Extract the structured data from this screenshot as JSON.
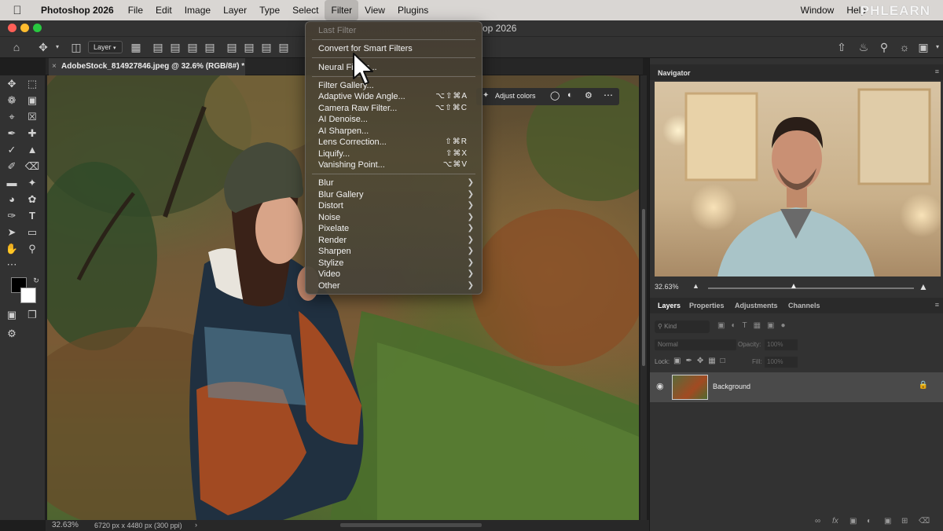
{
  "menubar": {
    "app_name": "Photoshop 2026",
    "items": [
      "File",
      "Edit",
      "Image",
      "Layer",
      "Type",
      "Select",
      "Filter",
      "View",
      "Plugins",
      "Window",
      "Help"
    ],
    "active_item": "Filter",
    "watermark": "PHLEARN"
  },
  "window": {
    "title": "op 2026"
  },
  "options_bar": {
    "layer_select": "Layer"
  },
  "document": {
    "tab_title": "AdobeStock_814927846.jpeg @ 32.6% (RGB/8#) *",
    "zoom": "32.63%",
    "dimensions": "6720 px x 4480 px (300 ppi)"
  },
  "taskbar": {
    "adjust_label": "Adjust colors"
  },
  "filter_menu": {
    "last_filter": "Last Filter",
    "convert": "Convert for Smart Filters",
    "neural": "Neural Filters...",
    "items": [
      {
        "label": "Filter Gallery...",
        "shortcut": ""
      },
      {
        "label": "Adaptive Wide Angle...",
        "shortcut": "⌥⇧⌘A"
      },
      {
        "label": "Camera Raw Filter...",
        "shortcut": "⌥⇧⌘C"
      },
      {
        "label": "AI Denoise...",
        "shortcut": ""
      },
      {
        "label": "AI Sharpen...",
        "shortcut": ""
      },
      {
        "label": "Lens Correction...",
        "shortcut": "⇧⌘R"
      },
      {
        "label": "Liquify...",
        "shortcut": "⇧⌘X"
      },
      {
        "label": "Vanishing Point...",
        "shortcut": "⌥⌘V"
      }
    ],
    "submenus": [
      "Blur",
      "Blur Gallery",
      "Distort",
      "Noise",
      "Pixelate",
      "Render",
      "Sharpen",
      "Stylize",
      "Video",
      "Other"
    ]
  },
  "navigator": {
    "title": "Navigator",
    "zoom": "32.63%"
  },
  "layers_panel": {
    "tabs": [
      "Layers",
      "Properties",
      "Adjustments",
      "Channels"
    ],
    "active_tab": "Layers",
    "kind_placeholder": "Kind",
    "blend_mode": "Normal",
    "opacity_label": "Opacity:",
    "opacity_value": "100%",
    "lock_label": "Lock:",
    "fill_label": "Fill:",
    "fill_value": "100%",
    "layer_name": "Background"
  }
}
